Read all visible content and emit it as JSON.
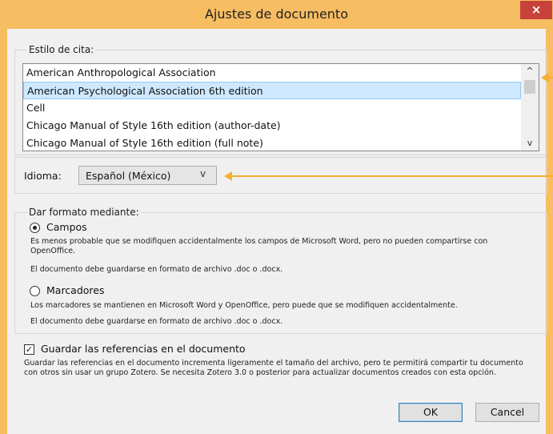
{
  "window": {
    "title": "Ajustes de documento",
    "close_glyph": "×"
  },
  "citation": {
    "legend": "Estilo de cita:",
    "items": [
      {
        "label": "American Anthropological Association"
      },
      {
        "label": "American Psychological Association 6th edition",
        "selected": true
      },
      {
        "label": "Cell"
      },
      {
        "label": "Chicago Manual of Style 16th edition (author-date)"
      },
      {
        "label": "Chicago Manual of Style 16th edition (full note)"
      }
    ],
    "scroll_up_glyph": "^",
    "scroll_down_glyph": "v"
  },
  "language": {
    "label": "Idioma:",
    "value": "Español (México)",
    "arrow_glyph": "v"
  },
  "format": {
    "legend": "Dar formato mediante:",
    "fields": {
      "label": "Campos",
      "selected": true,
      "desc1": "Es menos probable que se modifiquen accidentalmente los campos de Microsoft Word, pero no pueden compartirse con OpenOffice.",
      "desc2": "El documento debe guardarse en formato de archivo .doc o .docx."
    },
    "bookmarks": {
      "label": "Marcadores",
      "selected": false,
      "desc1": "Los marcadores se mantienen en Microsoft Word y OpenOffice, pero puede que se modifiquen accidentalmente.",
      "desc2": "El documento debe guardarse en formato de archivo .doc o .docx."
    }
  },
  "store": {
    "label": "Guardar las referencias en el documento",
    "checked": true,
    "check_glyph": "✓",
    "desc": "Guardar las referencias en el documento incrementa ligeramente el tamaño del archivo, pero te permitirá compartir tu documento con otros sin usar un grupo Zotero. Se necesita Zotero 3.0 o posterior para actualizar documentos creados con esta opción."
  },
  "buttons": {
    "ok": "OK",
    "cancel": "Cancel"
  },
  "colors": {
    "window_frame": "#f7bd62",
    "close_button": "#c7423a",
    "annotation_arrow": "#f4b030",
    "selection": "#cde8ff"
  }
}
